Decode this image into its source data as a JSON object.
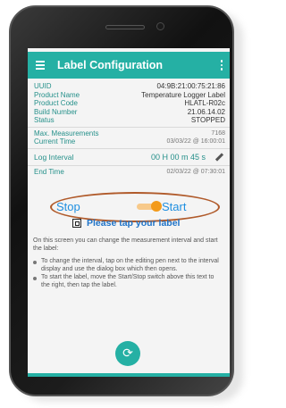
{
  "app": {
    "title": "Label Configuration"
  },
  "info": {
    "rows": [
      {
        "label": "UUID",
        "value": "04:9B:21:00:75:21:86"
      },
      {
        "label": "Product Name",
        "value": "Temperature Logger Label"
      },
      {
        "label": "Product Code",
        "value": "HLATL-R02c"
      },
      {
        "label": "Build Number",
        "value": "21.06.14.02"
      },
      {
        "label": "Status",
        "value": "STOPPED"
      }
    ],
    "max_measurements_label": "Max. Measurements",
    "max_measurements_value": "7168",
    "current_time_label": "Current Time",
    "current_time_value": "03/03/22 @ 16:00:01",
    "log_interval_label": "Log Interval",
    "log_interval_value": "00 H 00 m 45 s",
    "end_time_label": "End Time",
    "end_time_value": "02/03/22 @ 07:30:01"
  },
  "switch": {
    "stop_label": "Stop",
    "start_label": "Start",
    "state": "start"
  },
  "tap_prompt": "Please tap your label",
  "help": {
    "intro": "On this screen you can change the measurement interval and start the label:",
    "bullets": [
      "To change the interval, tap on the editing pen next to the interval display and use the dialog box which then opens.",
      "To start the label, move the Start/Stop switch above this text to the right, then tap the label."
    ]
  },
  "colors": {
    "accent": "#25b0a4",
    "switch_on": "#f39a1a",
    "highlight": "#b05a2a"
  },
  "icons": {
    "menu": "hamburger-menu-icon",
    "overflow": "kebab-menu-icon",
    "edit": "pen-icon",
    "nfc": "nfc-icon",
    "refresh": "refresh-icon"
  }
}
